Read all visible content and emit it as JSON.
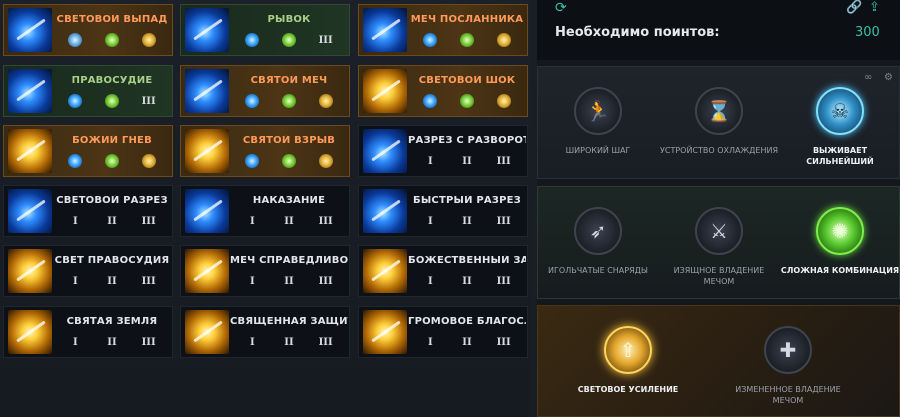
{
  "skills": [
    {
      "name": "Световой выпад",
      "style": "gold",
      "art": "blue",
      "runes": [
        "skull",
        "green",
        "gold"
      ]
    },
    {
      "name": "Рывок",
      "style": "green",
      "art": "blue",
      "runes": [
        "blue",
        "green",
        "III"
      ]
    },
    {
      "name": "Меч посланника",
      "style": "gold",
      "art": "blue",
      "runes": [
        "blue",
        "green",
        "gold"
      ]
    },
    {
      "name": "Правосудие",
      "style": "green",
      "art": "blue",
      "runes": [
        "blue",
        "green",
        "III"
      ]
    },
    {
      "name": "Святой меч",
      "style": "gold",
      "art": "blue",
      "runes": [
        "blue",
        "green",
        "gold"
      ]
    },
    {
      "name": "Световой шок",
      "style": "gold",
      "art": "gold",
      "runes": [
        "blue",
        "green",
        "gold"
      ]
    },
    {
      "name": "Божий гнев",
      "style": "gold",
      "art": "gold",
      "runes": [
        "blue",
        "green",
        "gold"
      ]
    },
    {
      "name": "Святой взрыв",
      "style": "gold",
      "art": "gold",
      "runes": [
        "blue",
        "green",
        "gold"
      ]
    },
    {
      "name": "Разрез с разворота",
      "style": "plain",
      "art": "blue",
      "runes": [
        "I",
        "II",
        "III"
      ]
    },
    {
      "name": "Световой разрез",
      "style": "plain",
      "art": "blue",
      "runes": [
        "I",
        "II",
        "III"
      ]
    },
    {
      "name": "Наказание",
      "style": "plain",
      "art": "blue",
      "runes": [
        "I",
        "II",
        "III"
      ]
    },
    {
      "name": "Быстрый разрез",
      "style": "plain",
      "art": "blue",
      "runes": [
        "I",
        "II",
        "III"
      ]
    },
    {
      "name": "Свет правосудия",
      "style": "plain",
      "art": "gold",
      "runes": [
        "I",
        "II",
        "III"
      ]
    },
    {
      "name": "Меч справедливос...",
      "style": "plain",
      "art": "gold",
      "runes": [
        "I",
        "II",
        "III"
      ]
    },
    {
      "name": "Божественный зак...",
      "style": "plain",
      "art": "gold",
      "runes": [
        "I",
        "II",
        "III"
      ]
    },
    {
      "name": "Святая земля",
      "style": "plain",
      "art": "gold",
      "runes": [
        "I",
        "II",
        "III"
      ]
    },
    {
      "name": "Священная защита",
      "style": "plain",
      "art": "gold",
      "runes": [
        "I",
        "II",
        "III"
      ]
    },
    {
      "name": "Громовое благосл...",
      "style": "plain",
      "art": "gold",
      "runes": [
        "I",
        "II",
        "III"
      ]
    }
  ],
  "header": {
    "points_label": "Необходимо поинтов:",
    "points_value": "300"
  },
  "passives": {
    "row1": [
      {
        "label": "Широкий шаг",
        "state": "inactive",
        "icon": "running-icon"
      },
      {
        "label": "Устройство охлаждения",
        "state": "inactive",
        "icon": "hourglass-icon"
      },
      {
        "label": "Выживает сильнейший",
        "state": "active-blue",
        "icon": "skull-icon"
      }
    ],
    "row2": [
      {
        "label": "Игольчатые снаряды",
        "state": "inactive",
        "icon": "needles-icon"
      },
      {
        "label": "Изящное владение мечом",
        "state": "inactive",
        "icon": "sword-stance-icon"
      },
      {
        "label": "Сложная комбинация",
        "state": "active-green",
        "icon": "burst-icon"
      }
    ],
    "row3": [
      {
        "label": "Световое усиление",
        "state": "active-gold",
        "icon": "light-surge-icon"
      },
      {
        "label": "Измененное владение мечом",
        "state": "inactive",
        "icon": "sword-plus-icon"
      }
    ]
  }
}
